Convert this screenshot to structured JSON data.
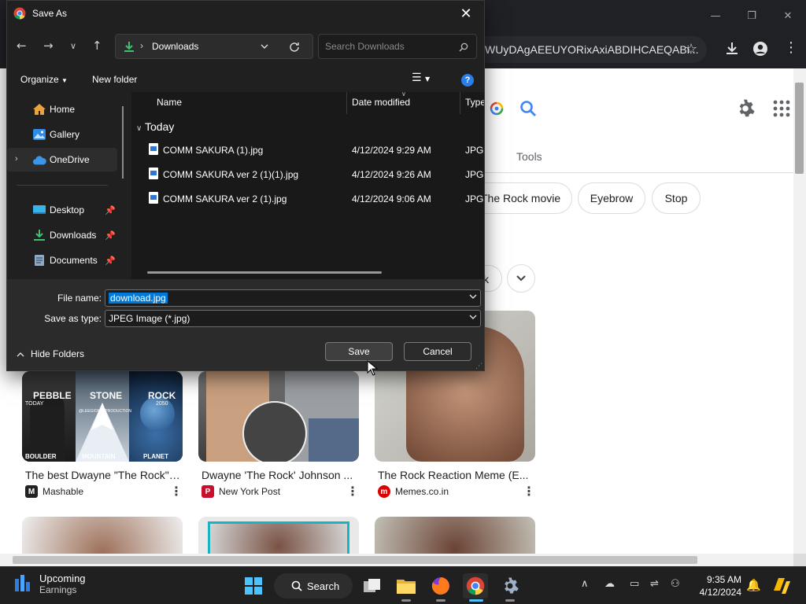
{
  "browser": {
    "omnibox_text": "WUyDAgAEEUYORixAxiABDIHCAEQABi..."
  },
  "google": {
    "tools_label": "Tools",
    "chips": [
      "The Rock movie",
      "Eyebrow",
      "Stop"
    ],
    "chip_fragment": "k",
    "results": [
      {
        "caption": "The best Dwayne \"The Rock\" Johnson ...",
        "source": "Mashable",
        "thumb_texts": [
          "PEBBLE",
          "STONE",
          "ROCK",
          "TODAY",
          "2050",
          "BOULDER",
          "MOUNTAIN",
          "PLANET",
          "@LEEGIONS_PRODUCTION"
        ]
      },
      {
        "caption": "Dwayne 'The Rock' Johnson ...",
        "source": "New York Post"
      },
      {
        "caption": "The Rock Reaction Meme (E...",
        "source": "Memes.co.in"
      }
    ]
  },
  "dialog": {
    "title": "Save As",
    "address": "Downloads",
    "search_placeholder": "Search Downloads",
    "organize_label": "Organize",
    "new_folder_label": "New folder",
    "help_label": "?",
    "nav_items": [
      {
        "label": "Home",
        "icon": "home-icon"
      },
      {
        "label": "Gallery",
        "icon": "gallery-icon"
      },
      {
        "label": "OneDrive",
        "icon": "cloud-icon"
      },
      {
        "label": "Desktop",
        "icon": "desktop-icon"
      },
      {
        "label": "Downloads",
        "icon": "download-icon"
      },
      {
        "label": "Documents",
        "icon": "document-icon"
      }
    ],
    "columns": {
      "name": "Name",
      "date": "Date modified",
      "type": "Type"
    },
    "group_label": "Today",
    "files": [
      {
        "name": "COMM SAKURA (1).jpg",
        "date": "4/12/2024 9:29 AM",
        "type": "JPG File"
      },
      {
        "name": "COMM SAKURA ver 2 (1)(1).jpg",
        "date": "4/12/2024 9:26 AM",
        "type": "JPG File"
      },
      {
        "name": "COMM SAKURA ver 2 (1).jpg",
        "date": "4/12/2024 9:06 AM",
        "type": "JPG File"
      }
    ],
    "file_name_label": "File name:",
    "file_name_value": "download.jpg",
    "save_type_label": "Save as type:",
    "save_type_value": "JPEG Image (*.jpg)",
    "hide_folders_label": "Hide Folders",
    "save_label": "Save",
    "cancel_label": "Cancel"
  },
  "taskbar": {
    "weather_title": "Upcoming",
    "weather_sub": "Earnings",
    "search_label": "Search",
    "time": "9:35 AM",
    "date": "4/12/2024"
  }
}
